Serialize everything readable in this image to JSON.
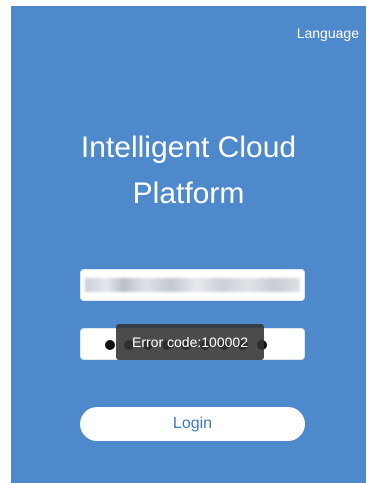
{
  "header": {
    "language_label": "Language"
  },
  "app": {
    "title_line1": "Intelligent Cloud",
    "title_line2": "Platform"
  },
  "form": {
    "username_value": "",
    "password_masked_count": 9,
    "login_label": "Login"
  },
  "toast": {
    "message": "Error code:100002"
  },
  "colors": {
    "background": "#4e89cc",
    "login_text": "#3a78c0",
    "toast_bg": "#323232"
  }
}
